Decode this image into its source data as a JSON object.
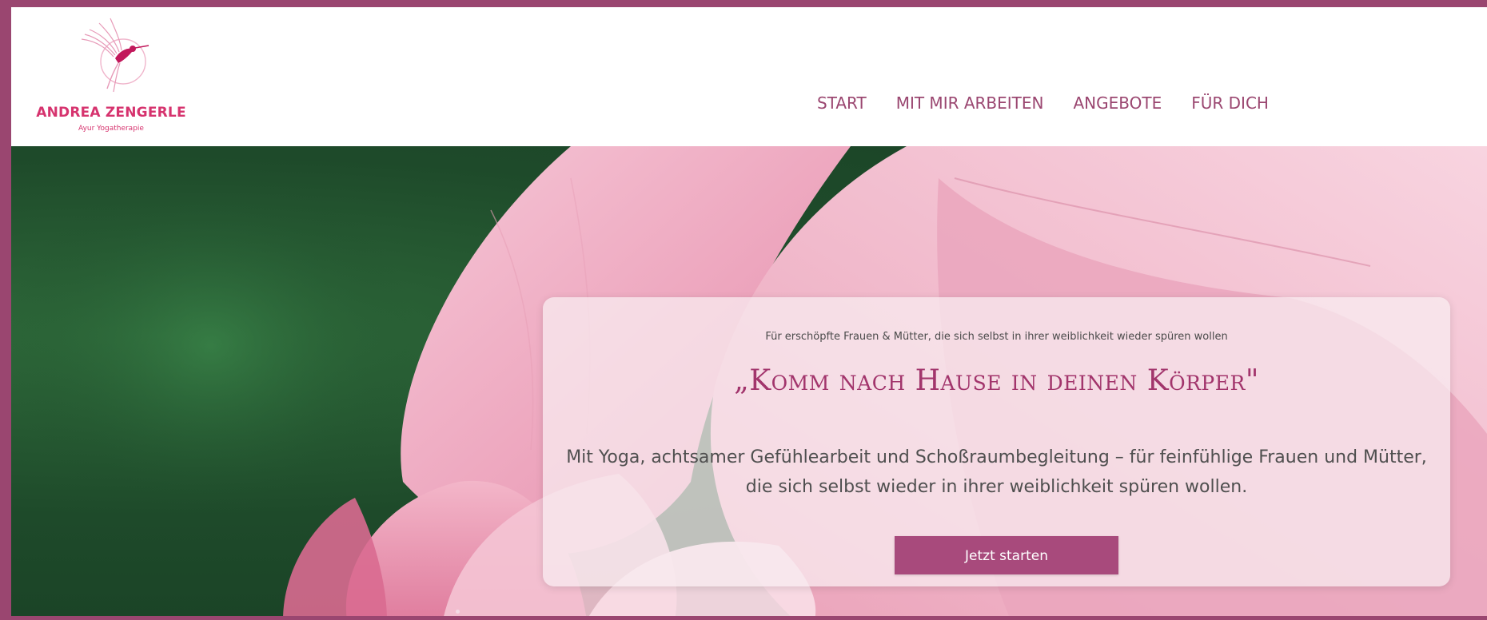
{
  "brand": {
    "name": "ANDREA ZENGERLE",
    "tagline": "Ayur Yogatherapie",
    "logo_icon": "hummingbird-icon"
  },
  "nav": {
    "items": [
      {
        "label": "START"
      },
      {
        "label": "MIT MIR ARBEITEN"
      },
      {
        "label": "ANGEBOTE"
      },
      {
        "label": "FÜR DICH"
      }
    ]
  },
  "hero": {
    "kicker": "Für erschöpfte Frauen & Mütter, die sich selbst in ihrer weiblichkeit wieder spüren wollen",
    "title": "„Komm nach Hause in deinen Körper\"",
    "body": "Mit Yoga, achtsamer Gefühlearbeit und Schoßraumbegleitung – für feinfühlige Frauen und Mütter, die sich selbst wieder in ihrer weiblichkeit spüren wollen.",
    "cta_label": "Jetzt starten"
  },
  "colors": {
    "frame": "#9a4670",
    "nav_text": "#9a4670",
    "brand_pink": "#d6336e",
    "title_text": "#a2356c",
    "cta_bg": "#a84a7c"
  }
}
